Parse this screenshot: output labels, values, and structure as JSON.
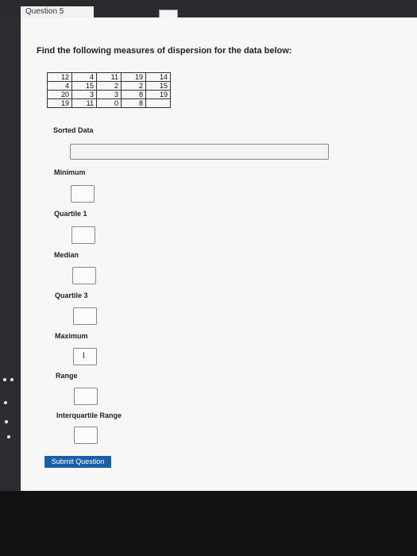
{
  "header": {
    "tab_label": "Question 5"
  },
  "question": {
    "prompt": "Find the following measures of dispersion for the data below:",
    "table": [
      [
        "12",
        "4",
        "11",
        "19",
        "14"
      ],
      [
        "4",
        "15",
        "2",
        "2",
        "15"
      ],
      [
        "20",
        "3",
        "3",
        "8",
        "19"
      ],
      [
        "19",
        "11",
        "0",
        "8",
        ""
      ]
    ]
  },
  "fields": {
    "sorted_data": {
      "label": "Sorted Data",
      "value": ""
    },
    "minimum": {
      "label": "Minimum",
      "value": ""
    },
    "quartile1": {
      "label": "Quartile 1",
      "value": ""
    },
    "median": {
      "label": "Median",
      "value": ""
    },
    "quartile3": {
      "label": "Quartile 3",
      "value": ""
    },
    "maximum": {
      "label": "Maximum",
      "value": ""
    },
    "range": {
      "label": "Range",
      "value": ""
    },
    "iqr": {
      "label": "Interquartile Range",
      "value": ""
    }
  },
  "submit_label": "Submit Question"
}
